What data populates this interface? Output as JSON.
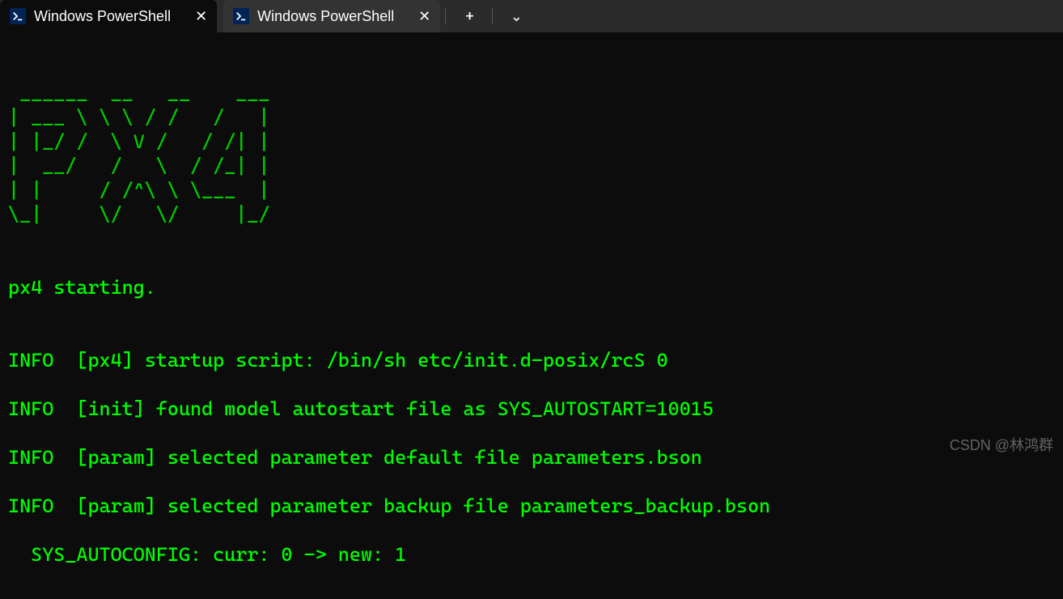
{
  "tabs": [
    {
      "title": "Windows PowerShell",
      "active": true
    },
    {
      "title": "Windows PowerShell",
      "active": false
    }
  ],
  "ascii_art": " ______  __   __    ___ \n| ___ \\ \\ \\ / /   /   |\n| |_/ /  \\ V /   / /| |\n|  __/   /   \\  / /_| |\n| |     / /^\\ \\ \\___  |\n\\_|     \\/   \\/     |_/",
  "output": {
    "starting": "px4 starting.",
    "lines": [
      "INFO  [px4] startup script: /bin/sh etc/init.d-posix/rcS 0",
      "INFO  [init] found model autostart file as SYS_AUTOSTART=10015",
      "INFO  [param] selected parameter default file parameters.bson",
      "INFO  [param] selected parameter backup file parameters_backup.bson",
      "  SYS_AUTOCONFIG: curr: 0 -> new: 1"
    ]
  },
  "watermark": "CSDN @林鸿群",
  "icons": {
    "close": "✕",
    "plus": "+",
    "chevron": "⌄",
    "ps": ">_"
  }
}
